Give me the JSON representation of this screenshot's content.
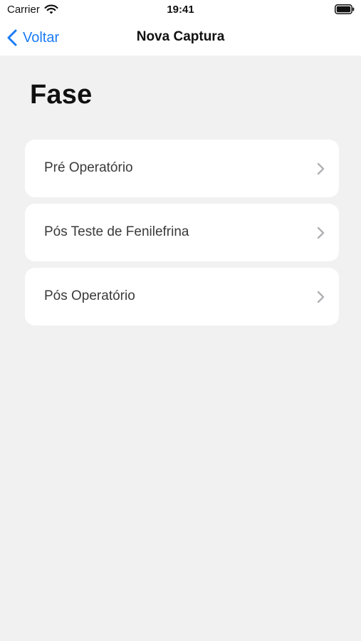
{
  "status_bar": {
    "carrier": "Carrier",
    "time": "19:41",
    "wifi_icon": "wifi-icon",
    "battery_icon": "battery-icon"
  },
  "nav": {
    "back_label": "Voltar",
    "back_icon": "chevron-left-icon",
    "title": "Nova Captura"
  },
  "page": {
    "title": "Fase"
  },
  "phases": [
    {
      "label": "Pré Operatório",
      "icon": "chevron-right-icon"
    },
    {
      "label": "Pós Teste de Fenilefrina",
      "icon": "chevron-right-icon"
    },
    {
      "label": "Pós Operatório",
      "icon": "chevron-right-icon"
    }
  ],
  "colors": {
    "accent": "#1a7cf5",
    "background": "#f1f1f2",
    "card": "#ffffff",
    "chevron": "#b0b0b5"
  }
}
